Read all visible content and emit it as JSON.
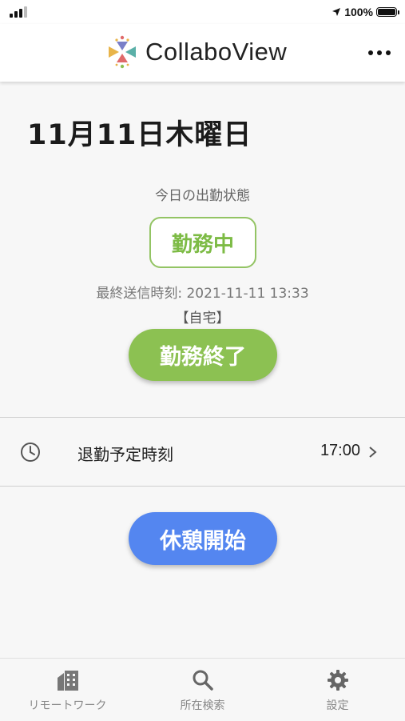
{
  "status_bar": {
    "battery": "100%"
  },
  "app": {
    "title": "CollaboView"
  },
  "main": {
    "date": "11月11日木曜日",
    "status_label": "今日の出勤状態",
    "status_badge": "勤務中",
    "last_sent": "最終送信時刻: 2021-11-11 13:33",
    "location": "【自宅】",
    "end_work_button": "勤務終了",
    "scheduled_leave": {
      "label": "退勤予定時刻",
      "value": "17:00"
    },
    "break_button": "休憩開始"
  },
  "tabs": [
    {
      "label": "リモートワーク",
      "icon": "building-icon"
    },
    {
      "label": "所在検索",
      "icon": "search-icon"
    },
    {
      "label": "設定",
      "icon": "gear-icon"
    }
  ],
  "colors": {
    "work_green": "#8cc152",
    "break_blue": "#5486f0",
    "badge_text": "#7dbb45"
  }
}
